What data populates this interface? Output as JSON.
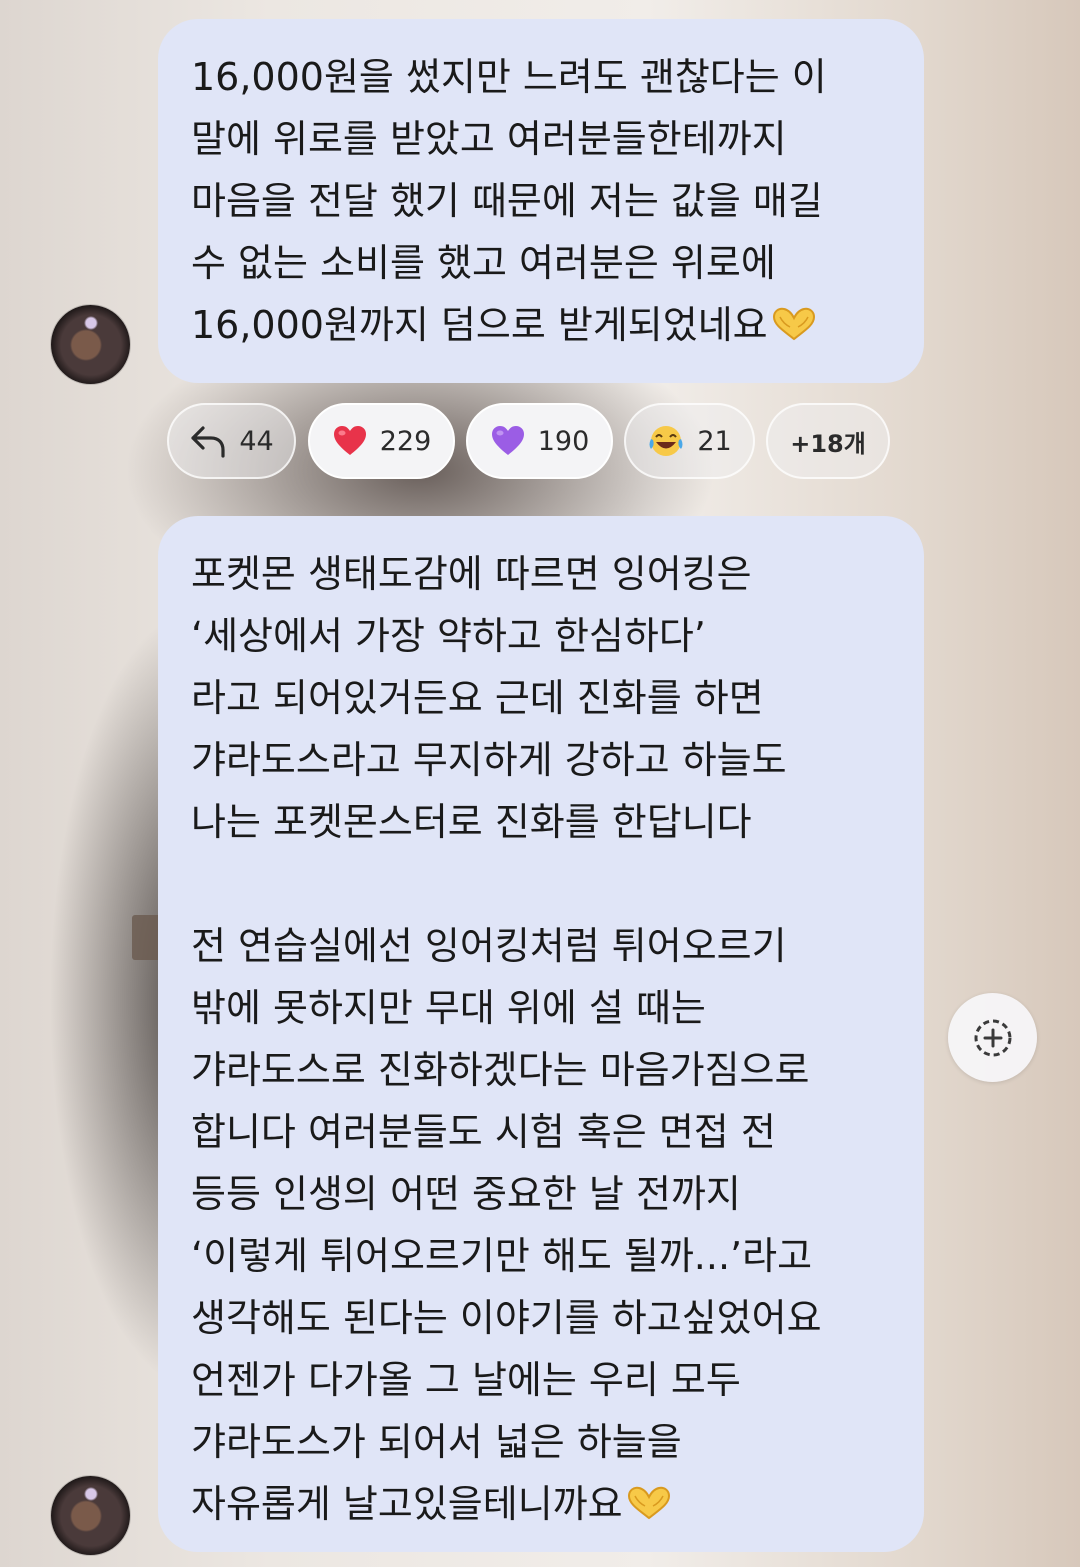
{
  "messages": [
    {
      "lines": [
        "16,000원을 썼지만 느려도 괜찮다는 이",
        "말에 위로를 받았고 여러분들한테까지",
        "마음을 전달 했기 때문에 저는 값을 매길",
        "수 없는 소비를 했고 여러분은 위로에",
        "16,000원까지 덤으로 받게되었네요"
      ],
      "trailing_emoji": "heart-hands-emoji"
    },
    {
      "lines": [
        "포켓몬 생태도감에 따르면 잉어킹은",
        "‘세상에서 가장 약하고 한심하다’",
        "라고 되어있거든요 근데 진화를 하면",
        "갸라도스라고 무지하게 강하고 하늘도",
        "나는 포켓몬스터로 진화를 한답니다",
        "",
        "전 연습실에선 잉어킹처럼 튀어오르기",
        "밖에 못하지만 무대 위에 설 때는",
        "갸라도스로 진화하겠다는 마음가짐으로",
        "합니다 여러분들도 시험 혹은 면접 전",
        "등등 인생의 어떤 중요한 날 전까지",
        "‘이렇게 튀어오르기만 해도 될까...’라고",
        "생각해도 된다는 이야기를 하고싶었어요",
        "언젠가 다가올 그 날에는 우리 모두",
        "갸라도스가 되어서 넓은 하늘을",
        "자유롭게 날고있을테니까요"
      ],
      "trailing_emoji": "heart-hands-emoji"
    }
  ],
  "reactions": {
    "reply": {
      "icon": "reply-arrow-icon",
      "count": "44"
    },
    "red_heart": {
      "icon": "red-heart-emoji",
      "count": "229"
    },
    "purple_heart": {
      "icon": "purple-heart-emoji",
      "count": "190"
    },
    "laughing": {
      "icon": "tears-of-joy-emoji",
      "count": "21"
    },
    "more": {
      "label": "+18개"
    }
  },
  "fab": {
    "icon": "add-reaction-icon"
  },
  "colors": {
    "bubble": "#e0e5f7",
    "text": "#1a1a1a",
    "red_heart": "#e8334a",
    "purple_heart": "#9b5de5",
    "emoji_yellow": "#f7c948"
  }
}
